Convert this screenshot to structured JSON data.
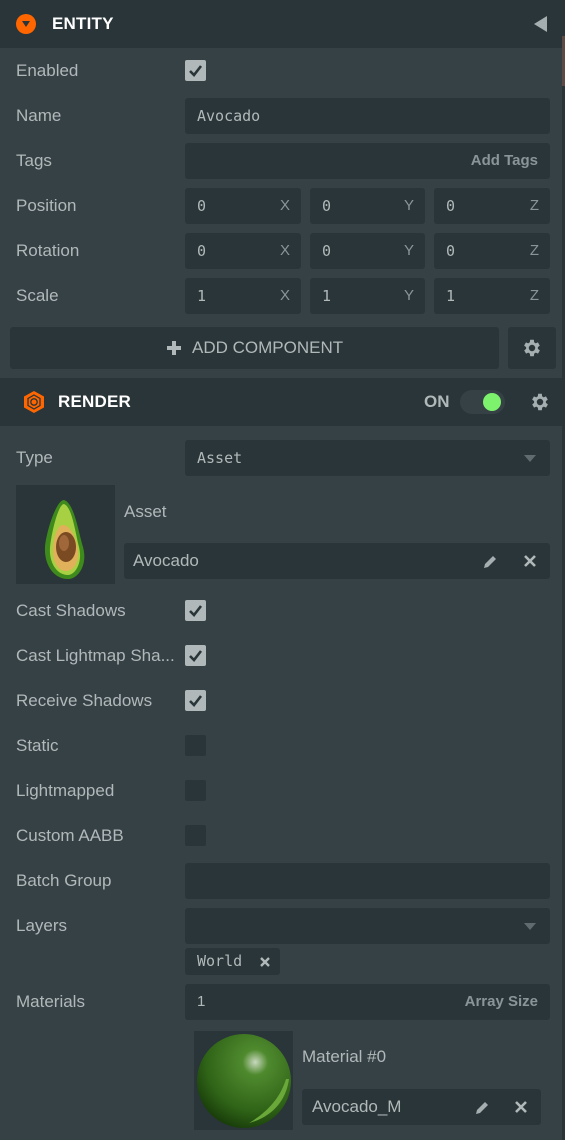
{
  "entity": {
    "title": "ENTITY",
    "header_icon": "entity-collapse-icon",
    "collapse_icon": "triangle-left-icon",
    "fields": {
      "enabled": {
        "label": "Enabled",
        "checked": true
      },
      "name": {
        "label": "Name",
        "value": "Avocado"
      },
      "tags": {
        "label": "Tags",
        "placeholder": "Add Tags"
      },
      "position": {
        "label": "Position",
        "x": "0",
        "y": "0",
        "z": "0"
      },
      "rotation": {
        "label": "Rotation",
        "x": "0",
        "y": "0",
        "z": "0"
      },
      "scale": {
        "label": "Scale",
        "x": "1",
        "y": "1",
        "z": "1"
      }
    },
    "axis_labels": {
      "x": "X",
      "y": "Y",
      "z": "Z"
    },
    "add_component_label": "ADD COMPONENT",
    "add_component_icon": "plus-icon",
    "settings_icon": "gear-icon"
  },
  "render": {
    "title": "RENDER",
    "header_icon": "render-component-icon",
    "toggle_label": "ON",
    "toggle_on": true,
    "toggle_color": "#7cf26d",
    "settings_icon": "gear-icon",
    "type": {
      "label": "Type",
      "value": "Asset"
    },
    "asset": {
      "label": "Asset",
      "value": "Avocado",
      "thumbnail": "avocado-thumbnail"
    },
    "cast_shadows": {
      "label": "Cast Shadows",
      "checked": true
    },
    "cast_lightmap_shadows": {
      "label": "Cast Lightmap Sha...",
      "checked": true
    },
    "receive_shadows": {
      "label": "Receive Shadows",
      "checked": true
    },
    "static": {
      "label": "Static",
      "checked": false
    },
    "lightmapped": {
      "label": "Lightmapped",
      "checked": false
    },
    "custom_aabb": {
      "label": "Custom AABB",
      "checked": false
    },
    "batch_group": {
      "label": "Batch Group",
      "value": ""
    },
    "layers": {
      "label": "Layers",
      "value": "",
      "tags": [
        "World"
      ]
    },
    "materials": {
      "label": "Materials",
      "array_size": "1",
      "array_size_hint": "Array Size",
      "items": [
        {
          "label": "Material #0",
          "value": "Avocado_M",
          "thumbnail": "material-sphere-thumbnail"
        }
      ]
    }
  },
  "colors": {
    "accent": "#ff6600",
    "header_bg": "#293538",
    "panel_bg": "#364146",
    "field_bg": "#293538",
    "text": "#b1b8ba",
    "toggle_on": "#7cf26d"
  }
}
